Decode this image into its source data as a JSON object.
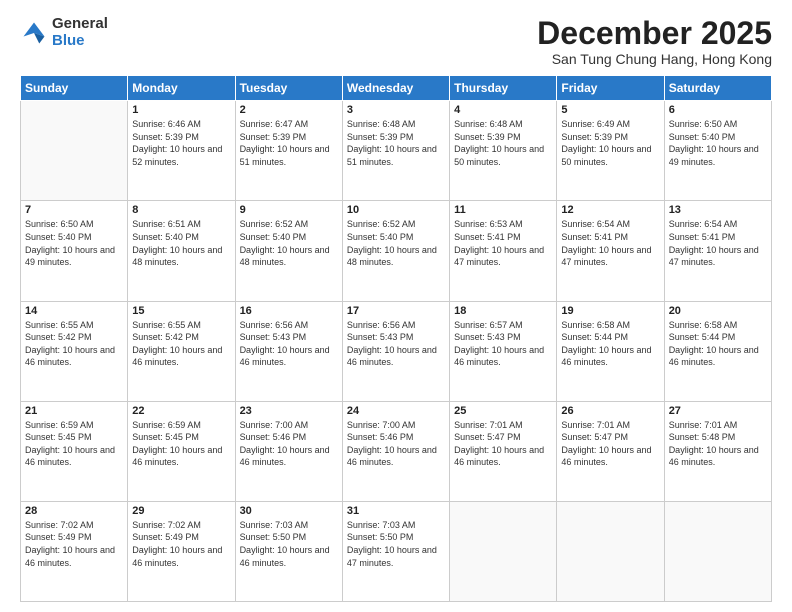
{
  "logo": {
    "general": "General",
    "blue": "Blue"
  },
  "header": {
    "month": "December 2025",
    "location": "San Tung Chung Hang, Hong Kong"
  },
  "weekdays": [
    "Sunday",
    "Monday",
    "Tuesday",
    "Wednesday",
    "Thursday",
    "Friday",
    "Saturday"
  ],
  "weeks": [
    [
      {
        "day": "",
        "sunrise": "",
        "sunset": "",
        "daylight": ""
      },
      {
        "day": "1",
        "sunrise": "6:46 AM",
        "sunset": "5:39 PM",
        "daylight": "10 hours and 52 minutes."
      },
      {
        "day": "2",
        "sunrise": "6:47 AM",
        "sunset": "5:39 PM",
        "daylight": "10 hours and 51 minutes."
      },
      {
        "day": "3",
        "sunrise": "6:48 AM",
        "sunset": "5:39 PM",
        "daylight": "10 hours and 51 minutes."
      },
      {
        "day": "4",
        "sunrise": "6:48 AM",
        "sunset": "5:39 PM",
        "daylight": "10 hours and 50 minutes."
      },
      {
        "day": "5",
        "sunrise": "6:49 AM",
        "sunset": "5:39 PM",
        "daylight": "10 hours and 50 minutes."
      },
      {
        "day": "6",
        "sunrise": "6:50 AM",
        "sunset": "5:40 PM",
        "daylight": "10 hours and 49 minutes."
      }
    ],
    [
      {
        "day": "7",
        "sunrise": "6:50 AM",
        "sunset": "5:40 PM",
        "daylight": "10 hours and 49 minutes."
      },
      {
        "day": "8",
        "sunrise": "6:51 AM",
        "sunset": "5:40 PM",
        "daylight": "10 hours and 48 minutes."
      },
      {
        "day": "9",
        "sunrise": "6:52 AM",
        "sunset": "5:40 PM",
        "daylight": "10 hours and 48 minutes."
      },
      {
        "day": "10",
        "sunrise": "6:52 AM",
        "sunset": "5:40 PM",
        "daylight": "10 hours and 48 minutes."
      },
      {
        "day": "11",
        "sunrise": "6:53 AM",
        "sunset": "5:41 PM",
        "daylight": "10 hours and 47 minutes."
      },
      {
        "day": "12",
        "sunrise": "6:54 AM",
        "sunset": "5:41 PM",
        "daylight": "10 hours and 47 minutes."
      },
      {
        "day": "13",
        "sunrise": "6:54 AM",
        "sunset": "5:41 PM",
        "daylight": "10 hours and 47 minutes."
      }
    ],
    [
      {
        "day": "14",
        "sunrise": "6:55 AM",
        "sunset": "5:42 PM",
        "daylight": "10 hours and 46 minutes."
      },
      {
        "day": "15",
        "sunrise": "6:55 AM",
        "sunset": "5:42 PM",
        "daylight": "10 hours and 46 minutes."
      },
      {
        "day": "16",
        "sunrise": "6:56 AM",
        "sunset": "5:43 PM",
        "daylight": "10 hours and 46 minutes."
      },
      {
        "day": "17",
        "sunrise": "6:56 AM",
        "sunset": "5:43 PM",
        "daylight": "10 hours and 46 minutes."
      },
      {
        "day": "18",
        "sunrise": "6:57 AM",
        "sunset": "5:43 PM",
        "daylight": "10 hours and 46 minutes."
      },
      {
        "day": "19",
        "sunrise": "6:58 AM",
        "sunset": "5:44 PM",
        "daylight": "10 hours and 46 minutes."
      },
      {
        "day": "20",
        "sunrise": "6:58 AM",
        "sunset": "5:44 PM",
        "daylight": "10 hours and 46 minutes."
      }
    ],
    [
      {
        "day": "21",
        "sunrise": "6:59 AM",
        "sunset": "5:45 PM",
        "daylight": "10 hours and 46 minutes."
      },
      {
        "day": "22",
        "sunrise": "6:59 AM",
        "sunset": "5:45 PM",
        "daylight": "10 hours and 46 minutes."
      },
      {
        "day": "23",
        "sunrise": "7:00 AM",
        "sunset": "5:46 PM",
        "daylight": "10 hours and 46 minutes."
      },
      {
        "day": "24",
        "sunrise": "7:00 AM",
        "sunset": "5:46 PM",
        "daylight": "10 hours and 46 minutes."
      },
      {
        "day": "25",
        "sunrise": "7:01 AM",
        "sunset": "5:47 PM",
        "daylight": "10 hours and 46 minutes."
      },
      {
        "day": "26",
        "sunrise": "7:01 AM",
        "sunset": "5:47 PM",
        "daylight": "10 hours and 46 minutes."
      },
      {
        "day": "27",
        "sunrise": "7:01 AM",
        "sunset": "5:48 PM",
        "daylight": "10 hours and 46 minutes."
      }
    ],
    [
      {
        "day": "28",
        "sunrise": "7:02 AM",
        "sunset": "5:49 PM",
        "daylight": "10 hours and 46 minutes."
      },
      {
        "day": "29",
        "sunrise": "7:02 AM",
        "sunset": "5:49 PM",
        "daylight": "10 hours and 46 minutes."
      },
      {
        "day": "30",
        "sunrise": "7:03 AM",
        "sunset": "5:50 PM",
        "daylight": "10 hours and 46 minutes."
      },
      {
        "day": "31",
        "sunrise": "7:03 AM",
        "sunset": "5:50 PM",
        "daylight": "10 hours and 47 minutes."
      },
      {
        "day": "",
        "sunrise": "",
        "sunset": "",
        "daylight": ""
      },
      {
        "day": "",
        "sunrise": "",
        "sunset": "",
        "daylight": ""
      },
      {
        "day": "",
        "sunrise": "",
        "sunset": "",
        "daylight": ""
      }
    ]
  ],
  "labels": {
    "sunrise": "Sunrise:",
    "sunset": "Sunset:",
    "daylight": "Daylight:"
  }
}
